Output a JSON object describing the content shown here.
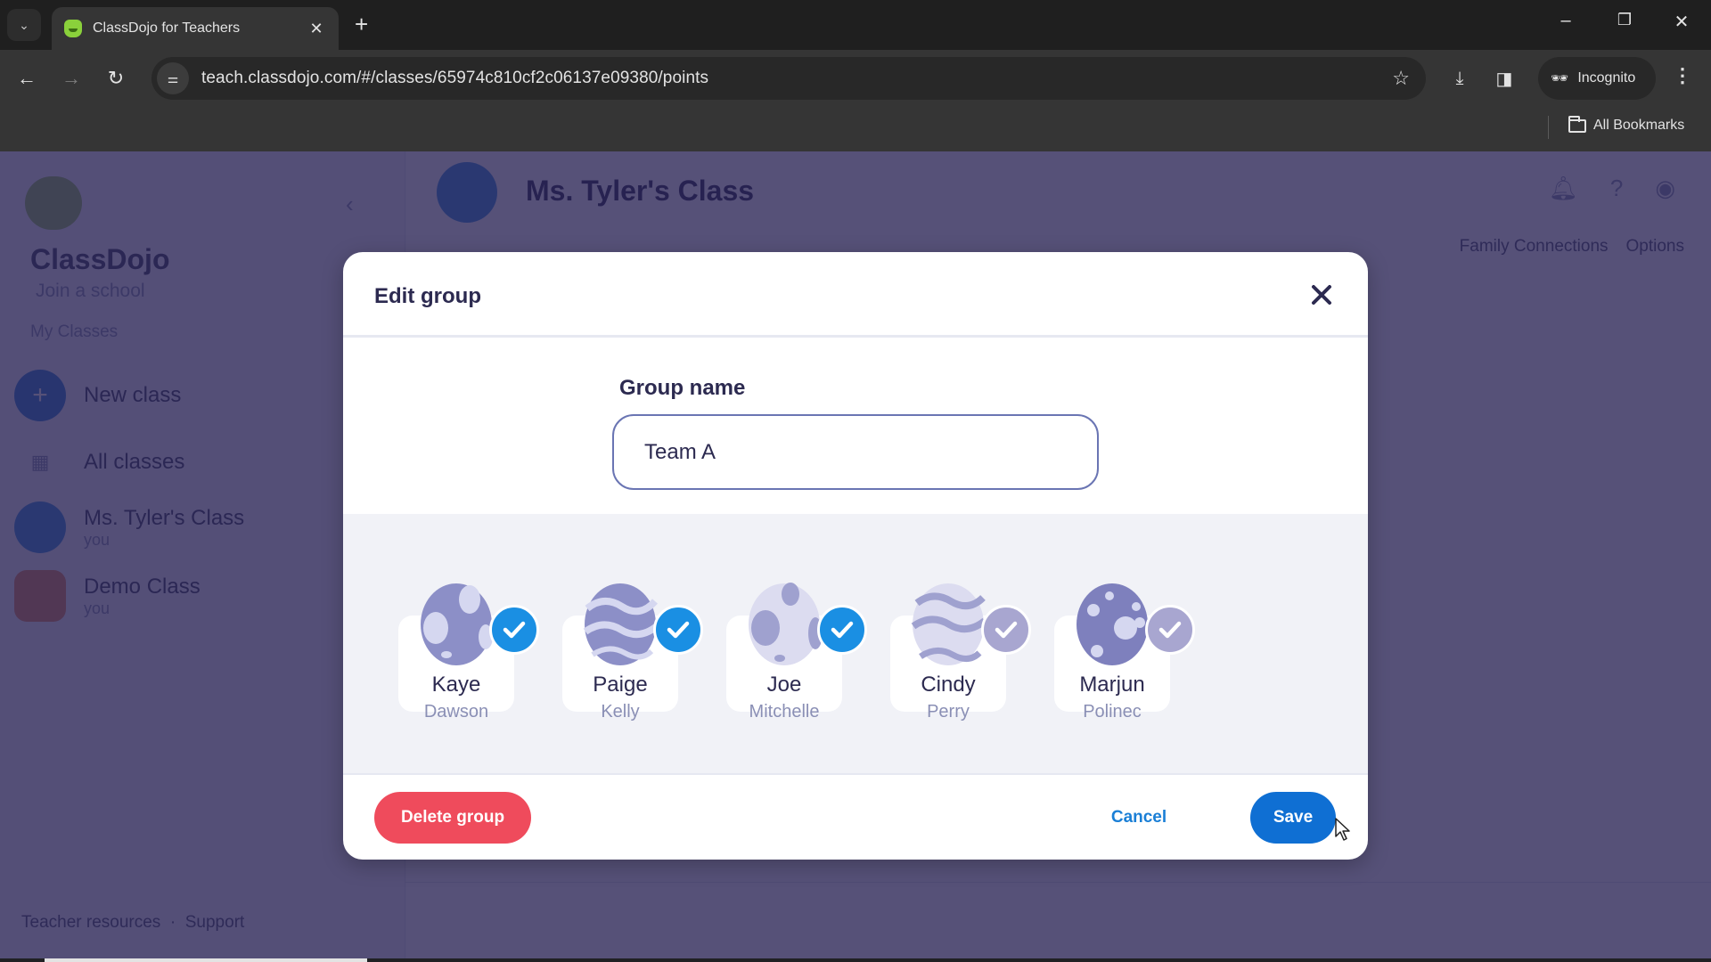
{
  "browser": {
    "tab_title": "ClassDojo for Teachers",
    "tab_close": "✕",
    "new_tab": "+",
    "url": "teach.classdojo.com/#/classes/65974c810cf2c06137e09380/points",
    "incognito_label": "Incognito",
    "bookmarks_label": "All Bookmarks",
    "window_controls": {
      "minimize": "–",
      "restore": "❐",
      "close": "✕"
    }
  },
  "background": {
    "sidebar": {
      "brand": "ClassDojo",
      "school_link": "Join a school",
      "section_title": "My Classes",
      "items": [
        {
          "label": "New class",
          "sub": ""
        },
        {
          "label": "All classes",
          "sub": ""
        },
        {
          "label": "Ms. Tyler's Class",
          "sub": "you"
        },
        {
          "label": "Demo Class",
          "sub": "you"
        }
      ],
      "footer_links": [
        "Teacher resources",
        "Support"
      ]
    },
    "class_title": "Ms. Tyler's Class",
    "nav_right": [
      "Family Connections",
      "Options"
    ]
  },
  "modal": {
    "title": "Edit group",
    "group_name_label": "Group name",
    "group_name_value": "Team A",
    "students": [
      {
        "first": "Kaye",
        "last": "Dawson",
        "selected": true,
        "egg": "spots"
      },
      {
        "first": "Paige",
        "last": "Kelly",
        "selected": true,
        "egg": "waves"
      },
      {
        "first": "Joe",
        "last": "Mitchelle",
        "selected": true,
        "egg": "light-spots"
      },
      {
        "first": "Cindy",
        "last": "Perry",
        "selected": false,
        "egg": "light-waves"
      },
      {
        "first": "Marjun",
        "last": "Polinec",
        "selected": false,
        "egg": "dark-spots"
      }
    ],
    "delete_label": "Delete group",
    "cancel_label": "Cancel",
    "save_label": "Save"
  },
  "colors": {
    "selected_check": "#1a8fe3",
    "unselected_check": "#a8a6d0",
    "delete": "#ef4b5c",
    "save": "#0f6fd3",
    "cancel_text": "#1a7fd6"
  }
}
